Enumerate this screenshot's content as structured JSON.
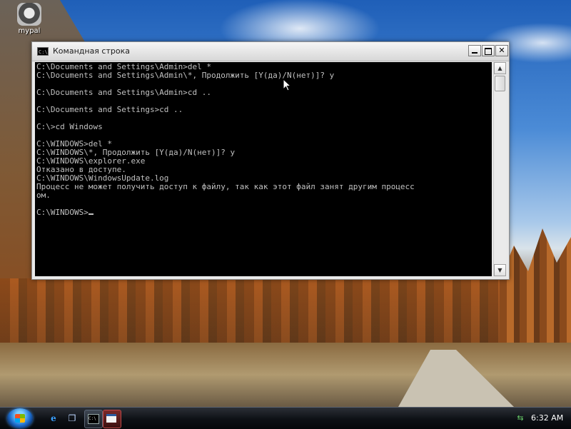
{
  "desktop": {
    "icon_label": "mypal"
  },
  "window": {
    "title": "Командная строка",
    "console_lines": [
      "C:\\Documents and Settings\\Admin>del *",
      "C:\\Documents and Settings\\Admin\\*, Продолжить [Y(да)/N(нет)]? y",
      "",
      "C:\\Documents and Settings\\Admin>cd ..",
      "",
      "C:\\Documents and Settings>cd ..",
      "",
      "C:\\>cd Windows",
      "",
      "C:\\WINDOWS>del *",
      "C:\\WINDOWS\\*, Продолжить [Y(да)/N(нет)]? y",
      "C:\\WINDOWS\\explorer.exe",
      "Отказано в доступе.",
      "C:\\WINDOWS\\WindowsUpdate.log",
      "Процесс не может получить доступ к файлу, так как этот файл занят другим процесс",
      "ом.",
      ""
    ],
    "prompt": "C:\\WINDOWS>"
  },
  "taskbar": {
    "clock": "6:32 AM",
    "colors": {
      "accent": "#1e6fd0",
      "console_bg": "#000000",
      "console_fg": "#c0c0c0"
    },
    "icons": [
      "windows-start-icon",
      "internet-explorer-icon",
      "switch-windows-icon",
      "command-prompt-icon",
      "application-window-icon",
      "network-tray-icon"
    ]
  }
}
